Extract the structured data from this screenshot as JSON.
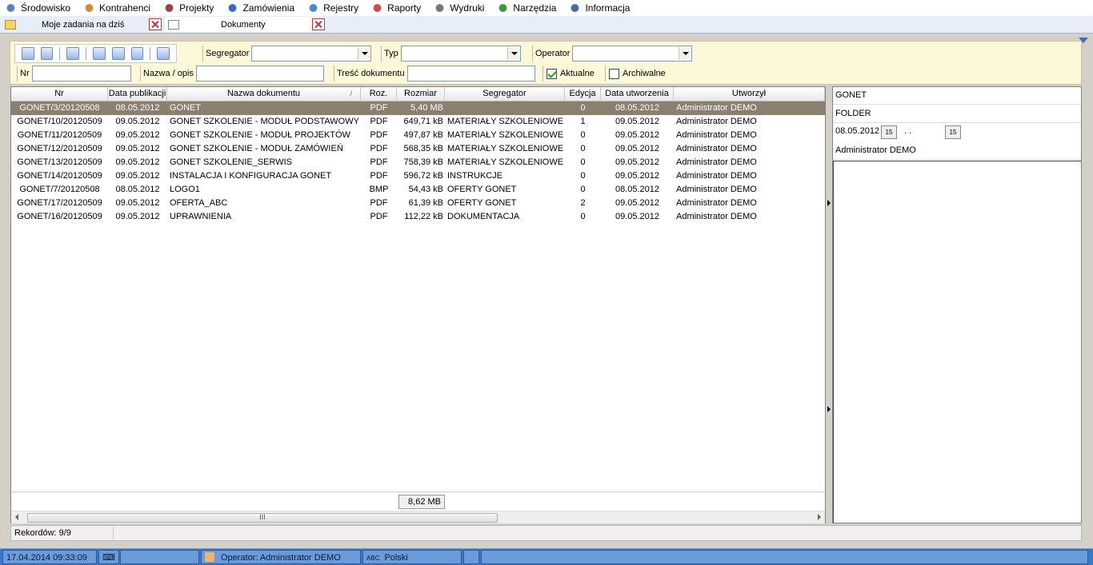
{
  "menu": [
    {
      "label": "Środowisko",
      "icon": "magnifier-icon"
    },
    {
      "label": "Kontrahenci",
      "icon": "person-icon"
    },
    {
      "label": "Projekty",
      "icon": "gear-icon"
    },
    {
      "label": "Zamówienia",
      "icon": "globe-icon"
    },
    {
      "label": "Rejestry",
      "icon": "register-icon"
    },
    {
      "label": "Raporty",
      "icon": "chart-icon"
    },
    {
      "label": "Wydruki",
      "icon": "printer-icon"
    },
    {
      "label": "Narzędzia",
      "icon": "tools-icon"
    },
    {
      "label": "Informacja",
      "icon": "info-icon"
    }
  ],
  "tabs": [
    {
      "label": "Moje zadania na dziś"
    },
    {
      "label": "Dokumenty"
    }
  ],
  "filters": {
    "segregator_label": "Segregator",
    "segregator_value": "",
    "typ_label": "Typ",
    "typ_value": "",
    "operator_label": "Operator",
    "operator_value": "",
    "nr_label": "Nr",
    "nazwa_label": "Nazwa / opis",
    "tresc_label": "Treść dokumentu",
    "aktualne_label": "Aktualne",
    "aktualne_checked": true,
    "archiwalne_label": "Archiwalne",
    "archiwalne_checked": false
  },
  "table": {
    "columns": [
      "Nr",
      "Data publikacji",
      "Nazwa dokumentu",
      "Roz.",
      "Rozmiar",
      "Segregator",
      "Edycja",
      "Data utworzenia",
      "Utworzył"
    ],
    "sort_indicator": "/",
    "rows": [
      [
        "GONET/3/20120508",
        "08.05.2012",
        "GONET",
        "PDF",
        "5,40 MB",
        "",
        "0",
        "08.05.2012",
        "Administrator DEMO"
      ],
      [
        "GONET/10/20120509",
        "09.05.2012",
        "GONET SZKOLENIE - MODUŁ PODSTAWOWY",
        "PDF",
        "649,71 kB",
        "MATERIAŁY SZKOLENIOWE",
        "1",
        "09.05.2012",
        "Administrator DEMO"
      ],
      [
        "GONET/11/20120509",
        "09.05.2012",
        "GONET SZKOLENIE - MODUŁ PROJEKTÓW",
        "PDF",
        "497,87 kB",
        "MATERIAŁY SZKOLENIOWE",
        "0",
        "09.05.2012",
        "Administrator DEMO"
      ],
      [
        "GONET/12/20120509",
        "09.05.2012",
        "GONET SZKOLENIE - MODUŁ ZAMÓWIEŃ",
        "PDF",
        "568,35 kB",
        "MATERIAŁY SZKOLENIOWE",
        "0",
        "09.05.2012",
        "Administrator DEMO"
      ],
      [
        "GONET/13/20120509",
        "09.05.2012",
        "GONET SZKOLENIE_SERWIS",
        "PDF",
        "758,39 kB",
        "MATERIAŁY SZKOLENIOWE",
        "0",
        "09.05.2012",
        "Administrator DEMO"
      ],
      [
        "GONET/14/20120509",
        "09.05.2012",
        "INSTALACJA I KONFIGURACJA GONET",
        "PDF",
        "596,72 kB",
        "INSTRUKCJE",
        "0",
        "09.05.2012",
        "Administrator DEMO"
      ],
      [
        "GONET/7/20120508",
        "08.05.2012",
        "LOGO1",
        "BMP",
        "54,43 kB",
        "OFERTY GONET",
        "0",
        "08.05.2012",
        "Administrator DEMO"
      ],
      [
        "GONET/17/20120509",
        "09.05.2012",
        "OFERTA_ABC",
        "PDF",
        "61,39 kB",
        "OFERTY GONET",
        "2",
        "09.05.2012",
        "Administrator DEMO"
      ],
      [
        "GONET/16/20120509",
        "09.05.2012",
        "UPRAWNIENIA",
        "PDF",
        "112,22 kB",
        "DOKUMENTACJA",
        "0",
        "09.05.2012",
        "Administrator DEMO"
      ]
    ],
    "selected_row": 0,
    "total_size": "8,62 MB",
    "scroll_grip": "III"
  },
  "detail": {
    "name": "GONET",
    "type": "FOLDER",
    "date1": "08.05.2012",
    "date2": " .  .",
    "date_btn": "15",
    "author": "Administrator DEMO"
  },
  "records": "Rekordów: 9/9",
  "status": {
    "datetime": "17.04.2014 09:33:09",
    "operator": "Operator: Administrator DEMO",
    "language": "Polski"
  },
  "colors": {
    "selected_row": "#8a8070",
    "status_bar": "#3b79c6",
    "filter_bg": "#fcf8d8"
  }
}
